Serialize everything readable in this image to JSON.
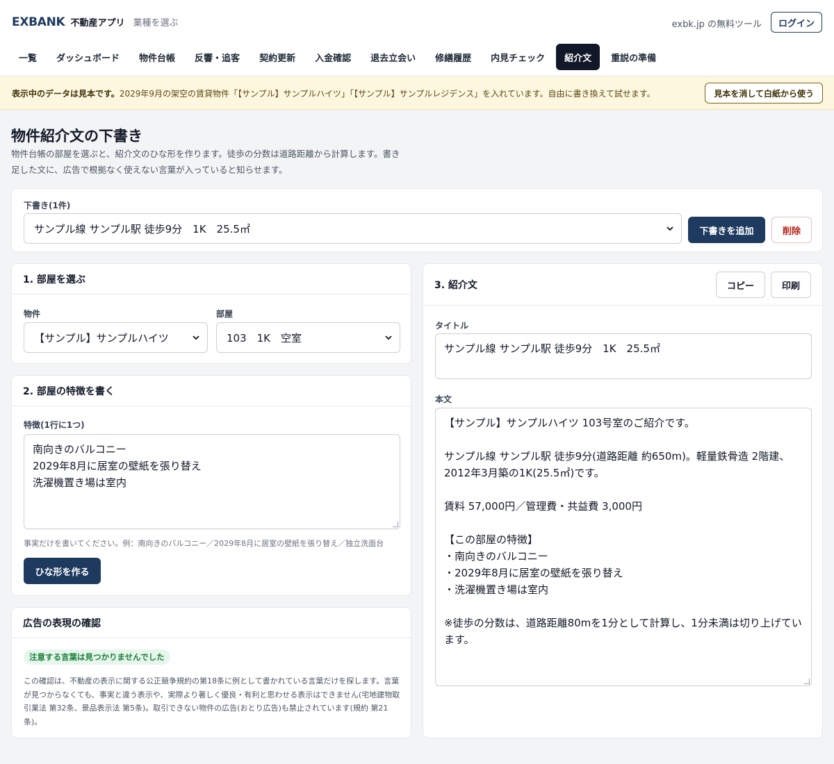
{
  "header": {
    "brand": "EXBANK",
    "app_name": "不動産アプリ",
    "industry_link": "業種を選ぶ",
    "free_tool": "exbk.jp の無料ツール",
    "login": "ログイン"
  },
  "nav": {
    "items": [
      {
        "label": "一覧"
      },
      {
        "label": "ダッシュボード"
      },
      {
        "label": "物件台帳"
      },
      {
        "label": "反響・追客"
      },
      {
        "label": "契約更新"
      },
      {
        "label": "入金確認"
      },
      {
        "label": "退去立会い"
      },
      {
        "label": "修繕履歴"
      },
      {
        "label": "内見チェック"
      },
      {
        "label": "紹介文",
        "active": true
      },
      {
        "label": "重説の準備"
      }
    ]
  },
  "banner": {
    "lead": "表示中のデータは見本です。",
    "text": "2029年9月の架空の賃貸物件「【サンプル】サンプルハイツ」「【サンプル】サンプルレジデンス」を入れています。自由に書き換えて試せます。",
    "button": "見本を消して白紙から使う"
  },
  "page": {
    "title": "物件紹介文の下書き",
    "description": "物件台帳の部屋を選ぶと、紹介文のひな形を作ります。徒歩の分数は道路距離から計算します。書き足した文に、広告で根拠なく使えない言葉が入っていると知らせます。"
  },
  "draft": {
    "label": "下書き(1件)",
    "selected": "サンプル線 サンプル駅 徒歩9分　1K　25.5㎡",
    "add_button": "下書きを追加",
    "delete_button": "削除"
  },
  "room": {
    "heading": "1. 部屋を選ぶ",
    "property_label": "物件",
    "property_value": "【サンプル】サンプルハイツ",
    "room_label": "部屋",
    "room_value": "103　1K　空室"
  },
  "features": {
    "heading": "2. 部屋の特徴を書く",
    "label": "特徴(1行に1つ)",
    "text": "南向きのバルコニー\n2029年8月に居室の壁紙を張り替え\n洗濯機置き場は室内",
    "hint": "事実だけを書いてください。例：南向きのバルコニー／2029年8月に居室の壁紙を張り替え／独立洗面台",
    "button": "ひな形を作る"
  },
  "ad_check": {
    "heading": "広告の表現の確認",
    "badge": "注意する言葉は見つかりませんでした",
    "note": "この確認は、不動産の表示に関する公正競争規約の第18条に例として書かれている言葉だけを探します。言葉が見つからなくても、事実と違う表示や、実際より著しく優良・有利と思わせる表示はできません(宅地建物取引業法 第32条、景品表示法 第5条)。取引できない物件の広告(おとり広告)も禁止されています(規約 第21条)。"
  },
  "intro": {
    "heading": "3. 紹介文",
    "copy_button": "コピー",
    "print_button": "印刷",
    "title_label": "タイトル",
    "title_value": "サンプル線 サンプル駅 徒歩9分　1K　25.5㎡",
    "body_label": "本文",
    "body_value": "【サンプル】サンプルハイツ 103号室のご紹介です。\n\nサンプル線 サンプル駅 徒歩9分(道路距離 約650m)。軽量鉄骨造 2階建、2012年3月築の1K(25.5㎡)です。\n\n賃料 57,000円／管理費・共益費 3,000円\n\n【この部屋の特徴】\n・南向きのバルコニー\n・2029年8月に居室の壁紙を張り替え\n・洗濯機置き場は室内\n\n※徒歩の分数は、道路距離80mを1分として計算し、1分未満は切り上げています。"
  },
  "colors": {
    "brand": "#1e3a5f",
    "nav_active": "#111827",
    "banner_bg": "#fef7e0",
    "ok_badge": "#1a7f37",
    "danger": "#b42318"
  }
}
